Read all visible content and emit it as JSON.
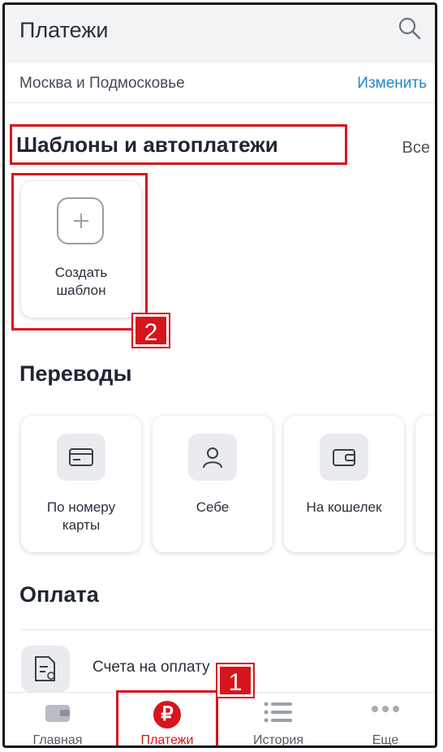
{
  "header": {
    "title": "Платежи"
  },
  "region": {
    "name": "Москва и Подмосковье",
    "change_label": "Изменить"
  },
  "templates": {
    "title": "Шаблоны и автоплатежи",
    "all_label": "Все",
    "create_line1": "Создать",
    "create_line2": "шаблон",
    "badge": "2"
  },
  "transfers": {
    "title": "Переводы",
    "items": [
      {
        "line1": "По номеру",
        "line2": "карты",
        "icon": "card-icon"
      },
      {
        "line1": "Себе",
        "line2": "",
        "icon": "person-icon"
      },
      {
        "line1": "На кошелек",
        "line2": "",
        "icon": "wallet-icon"
      }
    ]
  },
  "payment": {
    "title": "Оплата",
    "item_label": "Счета на оплату"
  },
  "bottom_nav": {
    "items": [
      {
        "label": "Главная",
        "icon": "wallet-icon"
      },
      {
        "label": "Платежи",
        "icon": "ruble-icon"
      },
      {
        "label": "История",
        "icon": "list-icon"
      },
      {
        "label": "Еще",
        "icon": "more-icon"
      }
    ],
    "badge": "1"
  },
  "colors": {
    "accent": "#d8141c",
    "link": "#1e88c8"
  }
}
